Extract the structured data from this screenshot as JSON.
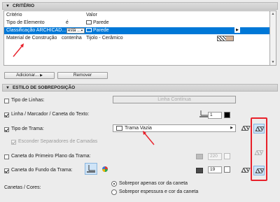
{
  "criteria": {
    "section_title": "CRITÉRIO",
    "columns": [
      "Critério",
      "Valor"
    ],
    "rows": [
      {
        "criterion": "Tipo de Elemento",
        "operator": "é",
        "value": "Parede"
      },
      {
        "criterion": "Classificação ARCHICAD...",
        "operator": "está ...",
        "value": "Parede"
      },
      {
        "criterion": "Material de Construção",
        "operator": "contenha",
        "value": "Tijolo - Cerâmico"
      }
    ],
    "add_button": "Adicionar...",
    "remove_button": "Remover"
  },
  "override": {
    "section_title": "ESTILO DE SOBREPOSIÇÃO",
    "line_type_label": "Tipo de Linhas:",
    "line_type_value": "Linha Contínua",
    "line_marker_label": "Linha / Marcador / Caneta do Texto:",
    "line_pen_number": "1",
    "fill_type_label": "Tipo de Trama:",
    "fill_type_value": "Trama Vazia",
    "hide_separators_label": "Esconder Separadores de Camadas",
    "foreground_pen_label": "Caneta do Primeiro Plano da Trama:",
    "foreground_pen_number": "220",
    "background_pen_label": "Caneta do Fundo da Trama:",
    "background_pen_number": "19",
    "pens_colors_label": "Canetas / Cores:",
    "radio_option_1": "Sobrepor apenas cor da caneta",
    "radio_option_2": "Sobrepor espessura e cor da caneta"
  },
  "colors": {
    "selection": "#0078d7",
    "annotation_red": "#e8202a",
    "material_fill": "#d4b298",
    "background_pen_swatch": "#4a4a4a"
  }
}
